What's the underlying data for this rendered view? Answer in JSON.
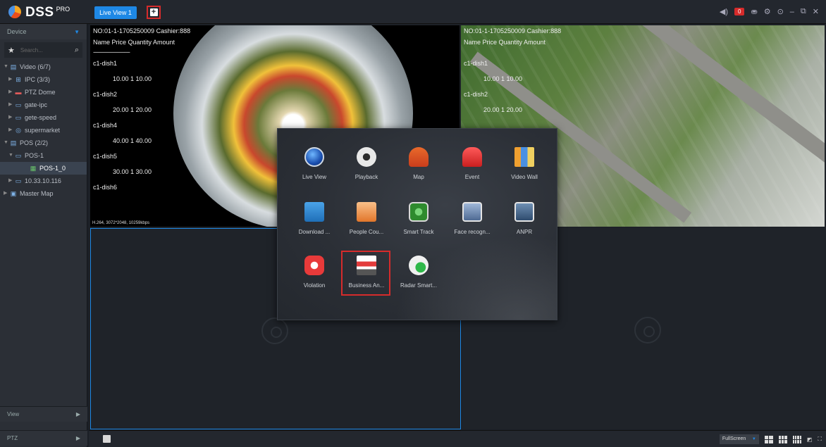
{
  "app": {
    "name": "DSS",
    "edition": "PRO"
  },
  "tabs": [
    {
      "label": "Live View 1"
    }
  ],
  "topbar": {
    "alarm_count": "0"
  },
  "sidebar": {
    "device_label": "Device",
    "search_placeholder": "Search...",
    "tree": [
      {
        "label": "Video (6/7)",
        "level": 0,
        "icon": "video-group-icon"
      },
      {
        "label": "IPC (3/3)",
        "level": 1,
        "icon": "ipc-group-icon"
      },
      {
        "label": "PTZ Dome",
        "level": 1,
        "icon": "ptz-dome-icon"
      },
      {
        "label": "gate-ipc",
        "level": 1,
        "icon": "camera-icon"
      },
      {
        "label": "gete-speed",
        "level": 1,
        "icon": "camera-icon"
      },
      {
        "label": "supermarket",
        "level": 1,
        "icon": "supermarket-icon"
      },
      {
        "label": "POS (2/2)",
        "level": 0,
        "icon": "pos-group-icon"
      },
      {
        "label": "POS-1",
        "level": 1,
        "icon": "pos-device-icon"
      },
      {
        "label": "POS-1_0",
        "level": 2,
        "icon": "pos-channel-icon",
        "selected": true
      },
      {
        "label": "10.33.10.116",
        "level": 1,
        "icon": "pos-device-icon"
      },
      {
        "label": "Master Map",
        "level": 0,
        "icon": "map-icon"
      }
    ],
    "view_label": "View",
    "ptz_label": "PTZ"
  },
  "panes": {
    "top_left": {
      "pos_header": "NO:01-1-1705250009  Cashier:888",
      "pos_columns": "Name   Price Quantity Amount",
      "pos_separator": "--------------------------",
      "pos_lines": [
        {
          "name": "c1-dish1",
          "amount": "10.00    1   10.00"
        },
        {
          "name": "c1-dish2",
          "amount": "20.00    1   20.00"
        },
        {
          "name": "c1-dish4",
          "amount": "40.00    1   40.00"
        },
        {
          "name": "c1-dish5",
          "amount": "30.00    1   30.00"
        },
        {
          "name": "c1-dish6",
          "amount": ""
        }
      ],
      "stream_info": "H.264, 3072*2048, 10259kbps"
    },
    "top_right": {
      "pos_header": "NO:01-1-1705250009  Cashier:888",
      "pos_columns": "Name   Price Quantity Amount",
      "pos_lines": [
        {
          "name": "c1-dish1",
          "amount": "10.00    1   10.00"
        },
        {
          "name": "c1-dish2",
          "amount": "20.00    1   20.00"
        }
      ]
    }
  },
  "app_menu": {
    "items": [
      {
        "label": "Live View",
        "icon": "live-view-icon"
      },
      {
        "label": "Playback",
        "icon": "playback-icon"
      },
      {
        "label": "Map",
        "icon": "map-pin-icon"
      },
      {
        "label": "Event",
        "icon": "event-alarm-icon"
      },
      {
        "label": "Video Wall",
        "icon": "video-wall-icon"
      },
      {
        "label": "Download ...",
        "icon": "download-icon"
      },
      {
        "label": "People Cou...",
        "icon": "people-counting-icon"
      },
      {
        "label": "Smart Track",
        "icon": "smart-track-icon"
      },
      {
        "label": "Face recogn...",
        "icon": "face-recognition-icon"
      },
      {
        "label": "ANPR",
        "icon": "anpr-icon"
      },
      {
        "label": "Violation",
        "icon": "violation-icon"
      },
      {
        "label": "Business An...",
        "icon": "business-analysis-icon",
        "highlighted": true
      },
      {
        "label": "Radar Smart...",
        "icon": "radar-smart-icon"
      }
    ]
  },
  "bottombar": {
    "fullscreen_label": "FullScreen"
  },
  "colors": {
    "accent": "#1e88e5",
    "highlight": "#d62b2b",
    "background": "#1b1f26"
  }
}
